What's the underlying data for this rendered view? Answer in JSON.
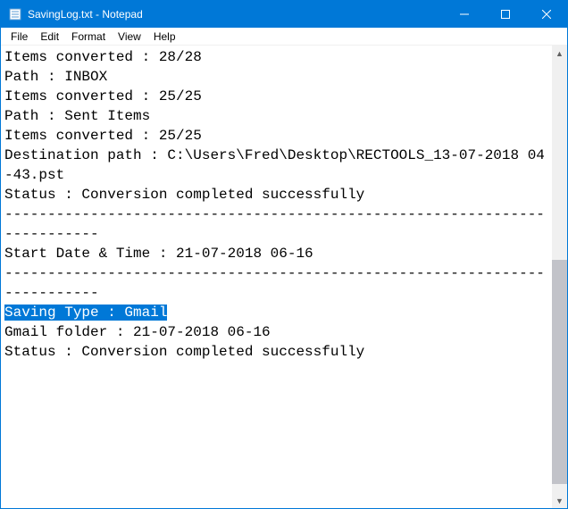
{
  "window": {
    "title": "SavingLog.txt - Notepad"
  },
  "menu": {
    "items": [
      "File",
      "Edit",
      "Format",
      "View",
      "Help"
    ]
  },
  "text": {
    "lines": [
      "Items converted : 28/28",
      "Path : INBOX",
      "Items converted : 25/25",
      "Path : Sent Items",
      "Items converted : 25/25",
      "",
      "",
      "Destination path : C:\\Users\\Fred\\Desktop\\RECTOOLS_13-07-2018 04-43.pst",
      "Status : Conversion completed successfully",
      "",
      "",
      "--------------------------------------------------------------------------",
      "Start Date & Time : 21-07-2018 06-16",
      "--------------------------------------------------------------------------",
      "Saving Type : Gmail",
      "",
      "",
      "Gmail folder : 21-07-2018 06-16",
      "Status : Conversion completed successfully",
      ""
    ],
    "selected_index": 14
  }
}
